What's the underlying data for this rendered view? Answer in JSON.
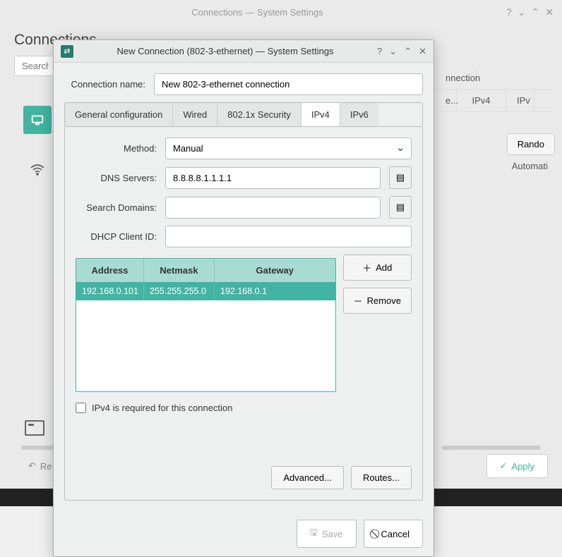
{
  "main_window": {
    "title": "Connections — System Settings",
    "header": "Connections",
    "search_placeholder": "Search",
    "right_panel": {
      "tab_connection": "nnection",
      "tab_wired": "e...",
      "tab_ipv4": "IPv4",
      "tab_ipv6": "IPv",
      "rando_button": "Rando",
      "automati_text": "Automati"
    },
    "footer": {
      "restore": "Re",
      "apply": "Apply"
    }
  },
  "dialog": {
    "title": "New Connection (802-3-ethernet) — System Settings",
    "connection_name_label": "Connection name:",
    "connection_name_value": "New 802-3-ethernet connection",
    "tabs": {
      "general": "General configuration",
      "wired": "Wired",
      "security": "802.1x Security",
      "ipv4": "IPv4",
      "ipv6": "IPv6"
    },
    "ipv4": {
      "method_label": "Method:",
      "method_value": "Manual",
      "dns_label": "DNS Servers:",
      "dns_value": "8.8.8.8.1.1.1.1",
      "search_domains_label": "Search Domains:",
      "search_domains_value": "",
      "dhcp_client_label": "DHCP Client ID:",
      "dhcp_client_value": "",
      "table": {
        "headers": {
          "address": "Address",
          "netmask": "Netmask",
          "gateway": "Gateway"
        },
        "rows": [
          {
            "address": "192.168.0.101",
            "netmask": "255.255.255.0",
            "gateway": "192.168.0.1"
          }
        ]
      },
      "add_button": "Add",
      "remove_button": "Remove",
      "required_checkbox": "IPv4 is required for this connection",
      "advanced_button": "Advanced...",
      "routes_button": "Routes..."
    },
    "footer": {
      "save": "Save",
      "cancel": "Cancel"
    }
  }
}
